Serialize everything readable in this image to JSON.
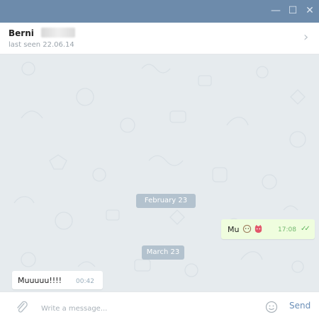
{
  "window": {
    "controls": {
      "minimize": "—",
      "maximize": "☐",
      "close": "✕"
    }
  },
  "header": {
    "contact_name": "Berni",
    "status": "last seen 22.06.14",
    "chevron": "›"
  },
  "chat": {
    "date_dividers": [
      "February 23",
      "March 23"
    ],
    "messages": [
      {
        "direction": "outgoing",
        "text": "Mu",
        "time": "17:08",
        "status": "read",
        "emoji": [
          "monkey-face",
          "cat-face"
        ]
      },
      {
        "direction": "incoming",
        "text": "Muuuuu!!!!",
        "time": "00:42"
      }
    ]
  },
  "composer": {
    "placeholder": "Write a message...",
    "send_label": "Send"
  },
  "colors": {
    "titlebar": "#6d8bab",
    "chat_bg": "#e6ebee",
    "outgoing_bubble": "#effdde",
    "date_pill": "#b3c2ce",
    "send": "#6b8fb8"
  }
}
